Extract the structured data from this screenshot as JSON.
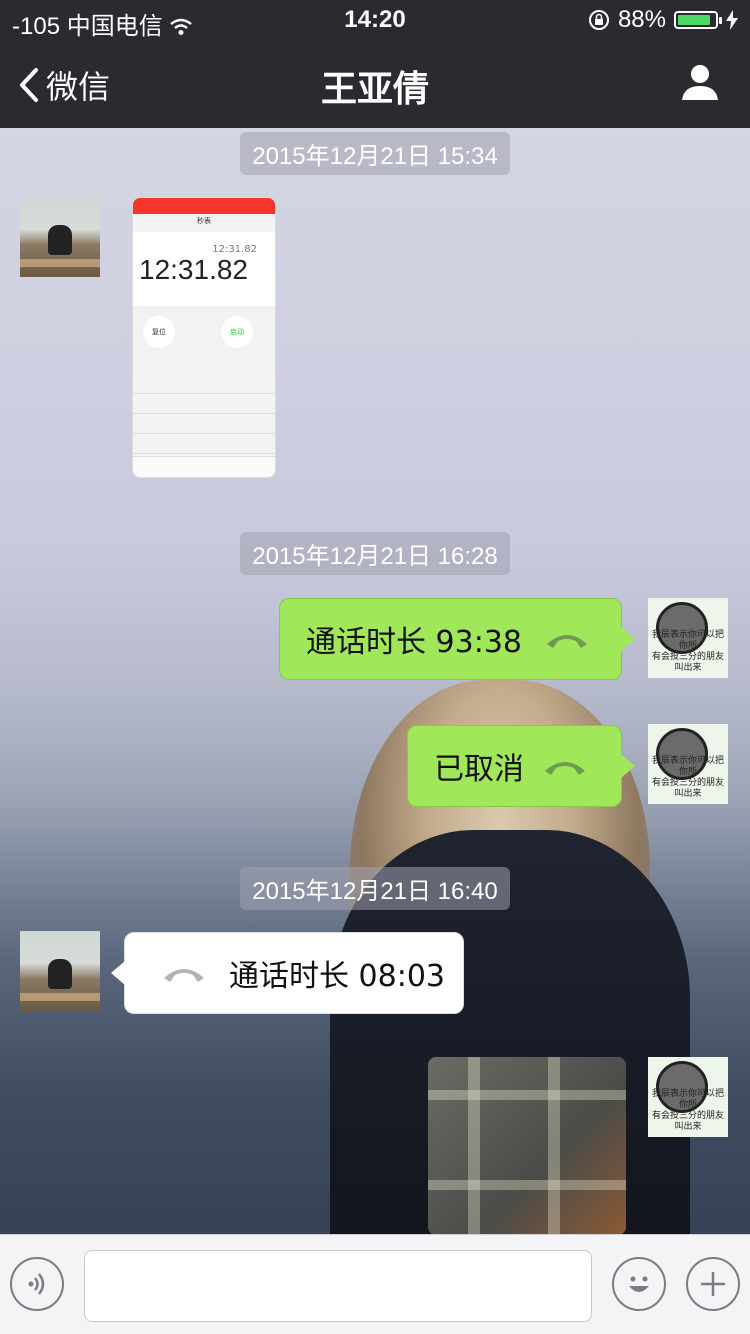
{
  "status": {
    "signal": "-105",
    "carrier": "中国电信",
    "time": "14:20",
    "battery": "88%",
    "battery_level": 0.88
  },
  "nav": {
    "back_label": "微信",
    "title": "王亚倩"
  },
  "stamps": [
    "2015年12月21日 15:34",
    "2015年12月21日 16:28",
    "2015年12月21日 16:40"
  ],
  "thumb": {
    "title": "秒表",
    "small": "12:31.82",
    "big": "12:31.82",
    "reset": "复位",
    "start": "启动"
  },
  "messages": {
    "call1": "通话时长 93:38",
    "cancel": "已取消",
    "call2": "通话时长 08:03"
  },
  "avatar_caption": [
    "我辰表示你可以把你所",
    "有会投三分的朋友叫出来"
  ]
}
